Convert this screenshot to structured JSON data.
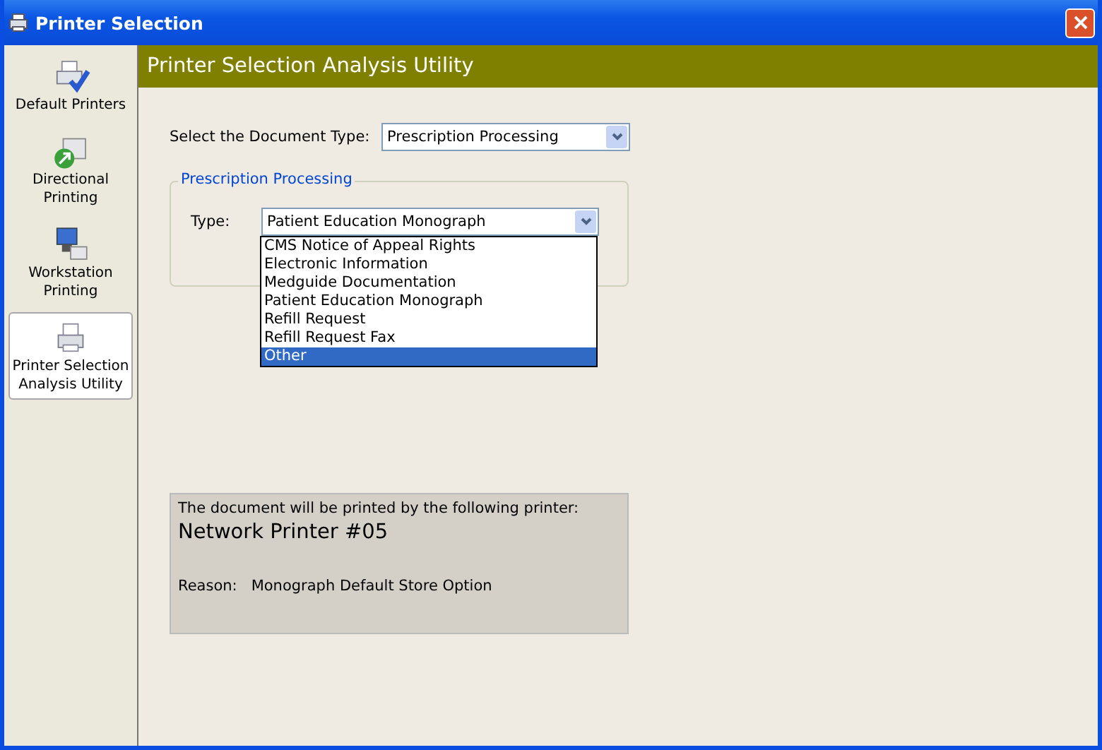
{
  "window": {
    "title": "Printer Selection"
  },
  "sidebar": {
    "items": [
      {
        "label": "Default Printers",
        "kind": "check",
        "selected": false
      },
      {
        "label": "Directional Printing",
        "kind": "arrow",
        "selected": false
      },
      {
        "label": "Workstation Printing",
        "kind": "computer",
        "selected": false
      },
      {
        "label": "Printer Selection Analysis Utility",
        "kind": "printer",
        "selected": true
      }
    ]
  },
  "header": {
    "title": "Printer Selection Analysis Utility"
  },
  "document_type": {
    "label": "Select the Document Type:",
    "value": "Prescription Processing"
  },
  "group": {
    "title": "Prescription Processing",
    "type_label": "Type:",
    "type_value": "Patient Education Monograph",
    "options": [
      {
        "label": "CMS Notice of Appeal Rights",
        "selected": false
      },
      {
        "label": "Electronic Information",
        "selected": false
      },
      {
        "label": "Medguide Documentation",
        "selected": false
      },
      {
        "label": "Patient Education Monograph",
        "selected": false
      },
      {
        "label": "Refill Request",
        "selected": false
      },
      {
        "label": "Refill Request Fax",
        "selected": false
      },
      {
        "label": "Other",
        "selected": true
      }
    ]
  },
  "result": {
    "intro": "The document will be printed by the following printer:",
    "printer": "Network Printer #05",
    "reason_label": "Reason:",
    "reason": "Monograph Default Store Option"
  }
}
